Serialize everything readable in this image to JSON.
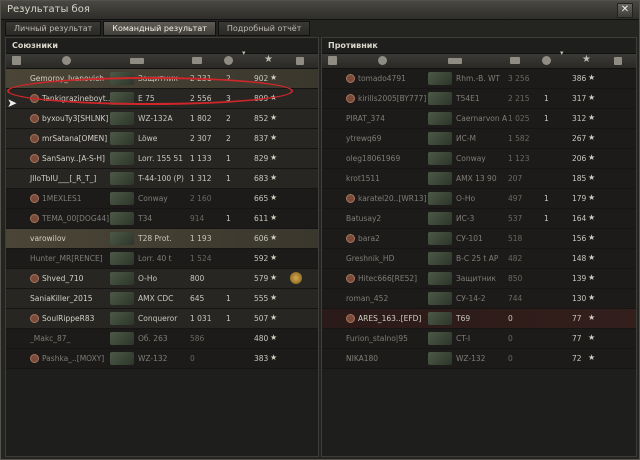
{
  "window": {
    "title": "Результаты боя",
    "close": "✕"
  },
  "tabs": [
    {
      "label": "Личный результат",
      "active": false
    },
    {
      "label": "Командный результат",
      "active": true
    },
    {
      "label": "Подробный отчёт",
      "active": false
    }
  ],
  "left": {
    "title": "Союзники",
    "rows": [
      {
        "name": "Gemoroy_Ivanovich",
        "tank": "Защитник",
        "dmg": "2 231",
        "kills": "2",
        "xp": "902",
        "state": "self",
        "clan": false
      },
      {
        "name": "Tankigrazineboyt...",
        "tank": "E 75",
        "dmg": "2 556",
        "kills": "3",
        "xp": "899",
        "state": "alive",
        "clan": true
      },
      {
        "name": "byxouTy3[SHLNK]",
        "tank": "WZ-132A",
        "dmg": "1 802",
        "kills": "2",
        "xp": "852",
        "state": "alive",
        "clan": true
      },
      {
        "name": "mrSatana[OMEN]",
        "tank": "Löwe",
        "dmg": "2 307",
        "kills": "2",
        "xp": "837",
        "state": "alive",
        "clan": true
      },
      {
        "name": "SanSany..[A-S-H]",
        "tank": "Lorr. 155 51",
        "dmg": "1 133",
        "kills": "1",
        "xp": "829",
        "state": "alive",
        "clan": true
      },
      {
        "name": "JlIoTbIU___[_R_T_]",
        "tank": "T-44-100 (P)",
        "dmg": "1 312",
        "kills": "1",
        "xp": "683",
        "state": "alive",
        "clan": false
      },
      {
        "name": "1MEXLES1",
        "tank": "Conway",
        "dmg": "2 160",
        "kills": "",
        "xp": "665",
        "state": "dead",
        "clan": true
      },
      {
        "name": "TEMA_00[DOG44]",
        "tank": "T34",
        "dmg": "914",
        "kills": "1",
        "xp": "611",
        "state": "dead",
        "clan": true
      },
      {
        "name": "varowilov",
        "tank": "T28 Prot.",
        "dmg": "1 193",
        "kills": "",
        "xp": "606",
        "state": "self2",
        "clan": false
      },
      {
        "name": "Hunter_MR[RENCE]",
        "tank": "Lorr. 40 t",
        "dmg": "1 524",
        "kills": "",
        "xp": "592",
        "state": "dead",
        "clan": false
      },
      {
        "name": "Shved_710",
        "tank": "O-Ho",
        "dmg": "800",
        "kills": "",
        "xp": "579",
        "state": "alive",
        "clan": true,
        "medal": true
      },
      {
        "name": "SaniaKiller_2015",
        "tank": "AMX CDC",
        "dmg": "645",
        "kills": "1",
        "xp": "555",
        "state": "alive",
        "clan": false
      },
      {
        "name": "SoulRippeR83",
        "tank": "Conqueror",
        "dmg": "1 031",
        "kills": "1",
        "xp": "507",
        "state": "alive",
        "clan": true
      },
      {
        "name": "_Makc_87_",
        "tank": "Об. 263",
        "dmg": "586",
        "kills": "",
        "xp": "480",
        "state": "dead",
        "clan": false
      },
      {
        "name": "Pashka_..[MOXY]",
        "tank": "WZ-132",
        "dmg": "0",
        "kills": "",
        "xp": "383",
        "state": "dead",
        "clan": true
      }
    ]
  },
  "right": {
    "title": "Противник",
    "rows": [
      {
        "name": "tomado4791",
        "tank": "Rhm.-B. WT",
        "dmg": "3 256",
        "kills": "",
        "xp": "386",
        "state": "dead",
        "clan": true
      },
      {
        "name": "kirills2005[BY777]",
        "tank": "T54E1",
        "dmg": "2 215",
        "kills": "1",
        "xp": "317",
        "state": "dead",
        "clan": true
      },
      {
        "name": "PIRAT_374",
        "tank": "Caernarvon A",
        "dmg": "1 025",
        "kills": "1",
        "xp": "312",
        "state": "dead",
        "clan": false
      },
      {
        "name": "ytrewq69",
        "tank": "ИС-М",
        "dmg": "1 582",
        "kills": "",
        "xp": "267",
        "state": "dead",
        "clan": false
      },
      {
        "name": "oleg18061969",
        "tank": "Conway",
        "dmg": "1 123",
        "kills": "",
        "xp": "206",
        "state": "dead",
        "clan": false
      },
      {
        "name": "krot1511",
        "tank": "AMX 13 90",
        "dmg": "207",
        "kills": "",
        "xp": "185",
        "state": "dead",
        "clan": false
      },
      {
        "name": "karatel20..[WR13]",
        "tank": "O-Ho",
        "dmg": "497",
        "kills": "1",
        "xp": "179",
        "state": "dead",
        "clan": true
      },
      {
        "name": "Batusay2",
        "tank": "ИС-3",
        "dmg": "537",
        "kills": "1",
        "xp": "164",
        "state": "dead",
        "clan": false
      },
      {
        "name": "bara2",
        "tank": "СУ-101",
        "dmg": "518",
        "kills": "",
        "xp": "156",
        "state": "dead",
        "clan": true
      },
      {
        "name": "Greshnik_HD",
        "tank": "B-C 25 t AP",
        "dmg": "482",
        "kills": "",
        "xp": "148",
        "state": "dead",
        "clan": false
      },
      {
        "name": "Hitec666[RE52]",
        "tank": "Защитник",
        "dmg": "850",
        "kills": "",
        "xp": "139",
        "state": "dead",
        "clan": true
      },
      {
        "name": "roman_452",
        "tank": "СУ-14-2",
        "dmg": "744",
        "kills": "",
        "xp": "130",
        "state": "dead",
        "clan": false
      },
      {
        "name": "ARES_163..[EFD]",
        "tank": "T69",
        "dmg": "0",
        "kills": "",
        "xp": "77",
        "state": "alive",
        "clan": true
      },
      {
        "name": "Furion_stalno|95",
        "tank": "CT-I",
        "dmg": "0",
        "kills": "",
        "xp": "77",
        "state": "dead",
        "clan": false
      },
      {
        "name": "NIKA180",
        "tank": "WZ-132",
        "dmg": "0",
        "kills": "",
        "xp": "72",
        "state": "dead",
        "clan": false
      }
    ]
  },
  "star_glyph": "★"
}
